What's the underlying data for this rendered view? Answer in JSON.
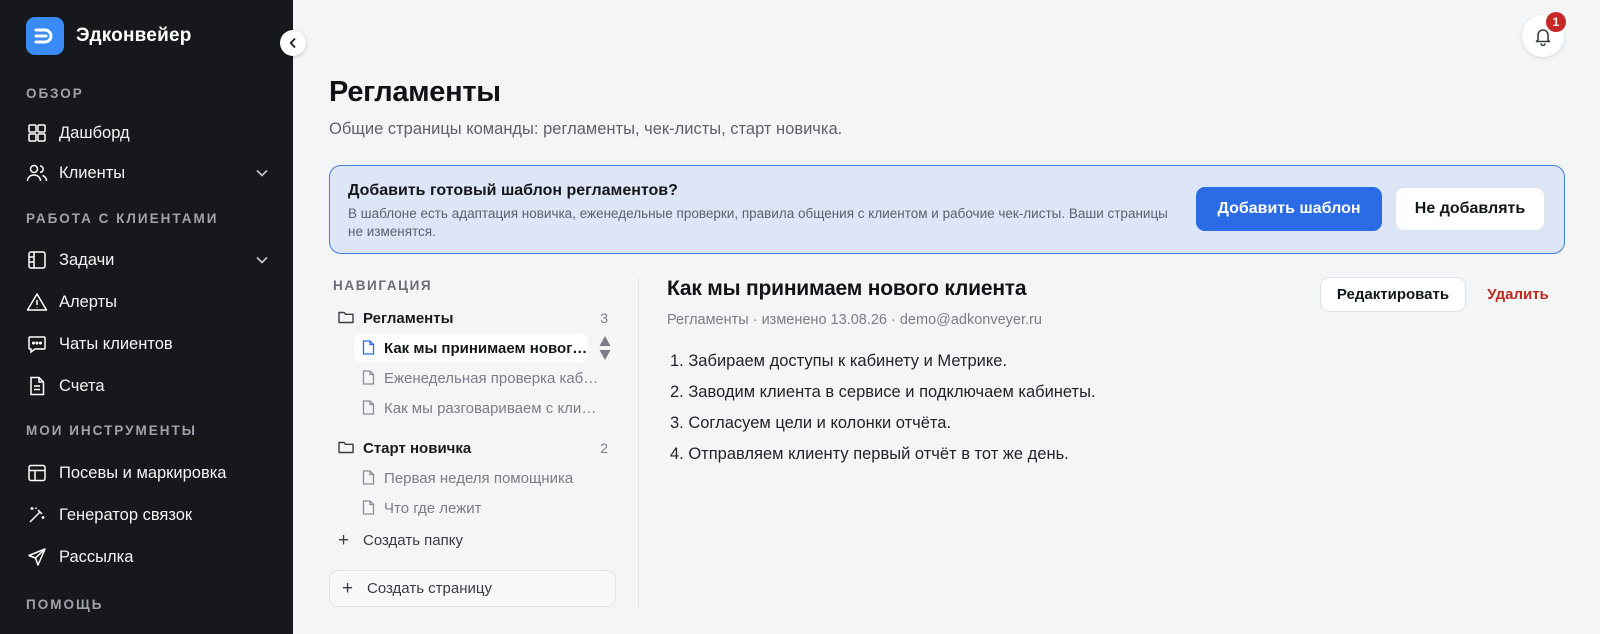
{
  "brand": {
    "name": "Эдконвейер"
  },
  "sidebar": {
    "sections": [
      {
        "title": "ОБЗОР"
      },
      {
        "title": "РАБОТА С КЛИЕНТАМИ"
      },
      {
        "title": "МОИ ИНСТРУМЕНТЫ"
      },
      {
        "title": "ПОМОЩЬ"
      }
    ],
    "items": [
      {
        "label": "Дашборд",
        "icon": "dashboard-icon"
      },
      {
        "label": "Клиенты",
        "icon": "users-icon",
        "expandable": true
      },
      {
        "label": "Задачи",
        "icon": "tasks-icon",
        "expandable": true
      },
      {
        "label": "Алерты",
        "icon": "alert-triangle-icon"
      },
      {
        "label": "Чаты клиентов",
        "icon": "chat-icon"
      },
      {
        "label": "Счета",
        "icon": "invoice-icon"
      },
      {
        "label": "Посевы и маркировка",
        "icon": "layout-icon"
      },
      {
        "label": "Генератор связок",
        "icon": "magic-wand-icon"
      },
      {
        "label": "Рассылка",
        "icon": "send-icon"
      }
    ]
  },
  "notifications": {
    "count": "1"
  },
  "header": {
    "title": "Регламенты",
    "subtitle": "Общие страницы команды: регламенты, чек-листы, старт новичка."
  },
  "banner": {
    "title": "Добавить готовый шаблон регламентов?",
    "text": "В шаблоне есть адаптация новичка, еженедельные проверки, правила общения с клиентом и рабочие чек-листы. Ваши страницы не изменятся.",
    "primary_label": "Добавить шаблон",
    "secondary_label": "Не добавлять",
    "border_color": "#3d7ee0",
    "bg_color": "#dde6f6"
  },
  "tree": {
    "title": "НАВИГАЦИЯ",
    "folders": [
      {
        "name": "Регламенты",
        "count": "3",
        "pages": [
          {
            "label": "Как мы принимаем нового клиента",
            "active": true
          },
          {
            "label": "Еженедельная проверка кабинетов",
            "active": false
          },
          {
            "label": "Как мы разговариваем с клиентом",
            "active": false
          }
        ]
      },
      {
        "name": "Старт новичка",
        "count": "2",
        "pages": [
          {
            "label": "Первая неделя помощника",
            "active": false
          },
          {
            "label": "Что где лежит",
            "active": false
          }
        ]
      }
    ],
    "create_folder_label": "Создать папку",
    "create_page_label": "Создать страницу"
  },
  "document": {
    "title": "Как мы принимаем нового клиента",
    "meta": "Регламенты · изменено 13.08.26 · demo@adkonveyer.ru",
    "edit_label": "Редактировать",
    "delete_label": "Удалить",
    "steps": [
      "1. Забираем доступы к кабинету и Метрике.",
      "2. Заводим клиента в сервисе и подключаем кабинеты.",
      "3. Согласуем цели и колонки отчёта.",
      "4. Отправляем клиенту первый отчёт в тот же день."
    ]
  },
  "colors": {
    "accent": "#2c6be6",
    "sidebar_bg": "#17181c",
    "danger": "#c0281f",
    "brand_logo": "#3a8bf5"
  }
}
